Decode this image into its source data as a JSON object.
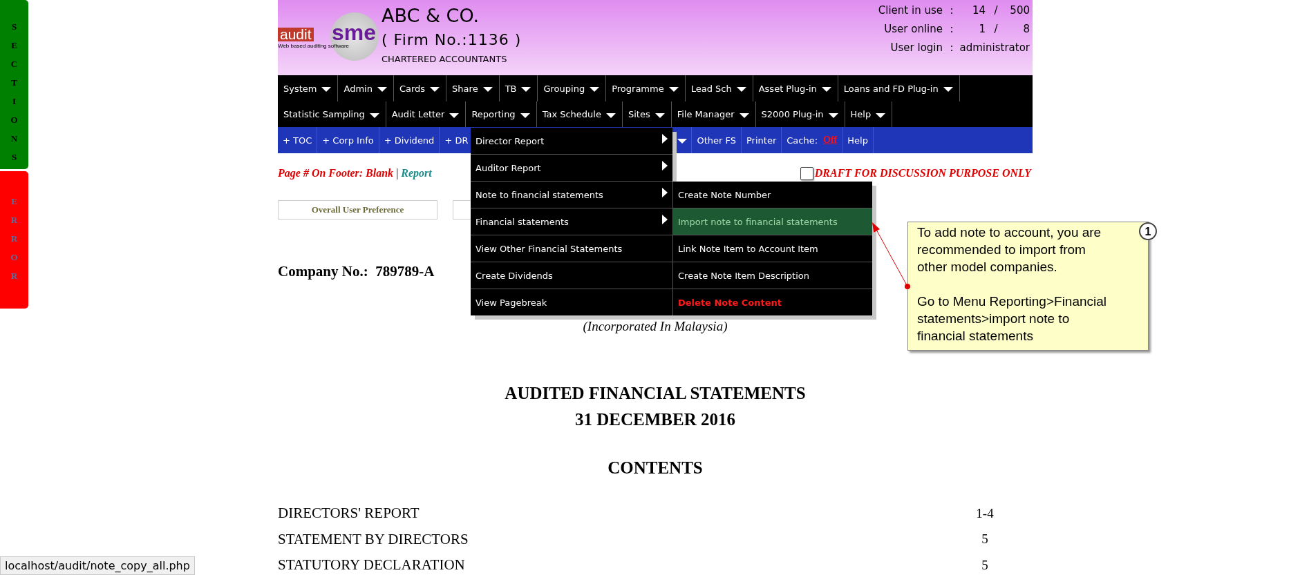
{
  "side_tabs": [
    {
      "label": "SECTIONS",
      "kind": "sections"
    },
    {
      "label": "ERROR",
      "kind": "error"
    }
  ],
  "header": {
    "logo": {
      "left": "audit",
      "right": "sme",
      "tagline": "Web based auditing software"
    },
    "firm_name": "ABC & CO.",
    "firm_no": "( Firm No.:1136 )",
    "subtitle": "CHARTERED ACCOUNTANTS",
    "stats": [
      {
        "kind": "ratio",
        "label": "Client in use",
        "colon": ":",
        "used": "14",
        "slash": "/",
        "total": "500"
      },
      {
        "kind": "ratio",
        "label": "User online",
        "colon": ":",
        "used": "1",
        "slash": "/",
        "total": "8"
      },
      {
        "kind": "text",
        "label": "User login",
        "colon": ":",
        "value": "administrator"
      }
    ]
  },
  "menu_bar": {
    "upper_row": {
      "items": [
        "System",
        "Admin",
        "Cards",
        "Share",
        "TB",
        "Grouping",
        "Programme",
        "Lead Sch",
        "Asset Plug-in",
        "Loans and FD Plug-in"
      ]
    },
    "lower_row": {
      "items": [
        "Statistic Sampling",
        "Audit Letter",
        "Reporting",
        "Tax Schedule",
        "Sites",
        "File Manager",
        "S2000 Plug-in",
        "Help"
      ]
    }
  },
  "toolbar": [
    {
      "kind": "link",
      "label": "+ TOC"
    },
    {
      "kind": "link",
      "label": "+ Corp Info"
    },
    {
      "kind": "link",
      "label": "+ Dividend"
    },
    {
      "kind": "link",
      "label": "+ DR"
    },
    {
      "kind": "caret"
    },
    {
      "kind": "link",
      "label": "Other FS"
    },
    {
      "kind": "link",
      "label": "Printer"
    },
    {
      "kind": "cache",
      "label": "Cache:",
      "value": "Off"
    },
    {
      "kind": "link",
      "label": "Help"
    }
  ],
  "dropdown": {
    "items": [
      {
        "label": "Director Report",
        "submenu": true
      },
      {
        "label": "Auditor Report",
        "submenu": true
      },
      {
        "label": "Note to financial statements",
        "submenu": true
      },
      {
        "label": "Financial statements",
        "submenu": true
      },
      {
        "label": "View Other Financial Statements",
        "submenu": false
      },
      {
        "label": "Create Dividends",
        "submenu": false
      },
      {
        "label": "View Pagebreak",
        "submenu": false
      }
    ],
    "submenu": [
      {
        "label": "Create Note Number",
        "kind": "normal",
        "selected": false
      },
      {
        "label": "Import note to financial statements",
        "kind": "normal",
        "selected": true
      },
      {
        "label": "Link Note Item to Account Item",
        "kind": "normal",
        "selected": false
      },
      {
        "label": "Create Note Item Description",
        "kind": "normal",
        "selected": false
      },
      {
        "label": "Delete Note Content",
        "kind": "danger",
        "selected": false
      }
    ]
  },
  "footer_setting": {
    "label": "Page # On Footer: Blank",
    "separator": "|",
    "link": "Report"
  },
  "draft": {
    "checked": false,
    "label": "DRAFT FOR DISCUSSION PURPOSE ONLY"
  },
  "preferences": [
    {
      "kind": "button",
      "label": "Overall User Preference"
    },
    {
      "kind": "covered"
    }
  ],
  "document": {
    "company_no": "Company No.:  789789-A",
    "incorporated": "(Incorporated In Malaysia)",
    "title": "AUDITED FINANCIAL STATEMENTS",
    "date": "31 DECEMBER 2016",
    "contents_heading": "CONTENTS",
    "contents": [
      {
        "title": "DIRECTORS' REPORT",
        "page": "1-4"
      },
      {
        "title": "STATEMENT BY DIRECTORS",
        "page": "5"
      },
      {
        "title": "STATUTORY DECLARATION",
        "page": "5"
      }
    ]
  },
  "callout": {
    "number": "1",
    "paragraphs": [
      "To add note to account, you are recommended to import from other model companies.",
      "Go to Menu Reporting>Financial statements>import note to financial statements"
    ]
  },
  "status_bar": {
    "url": "localhost/audit/note_copy_all.php"
  }
}
